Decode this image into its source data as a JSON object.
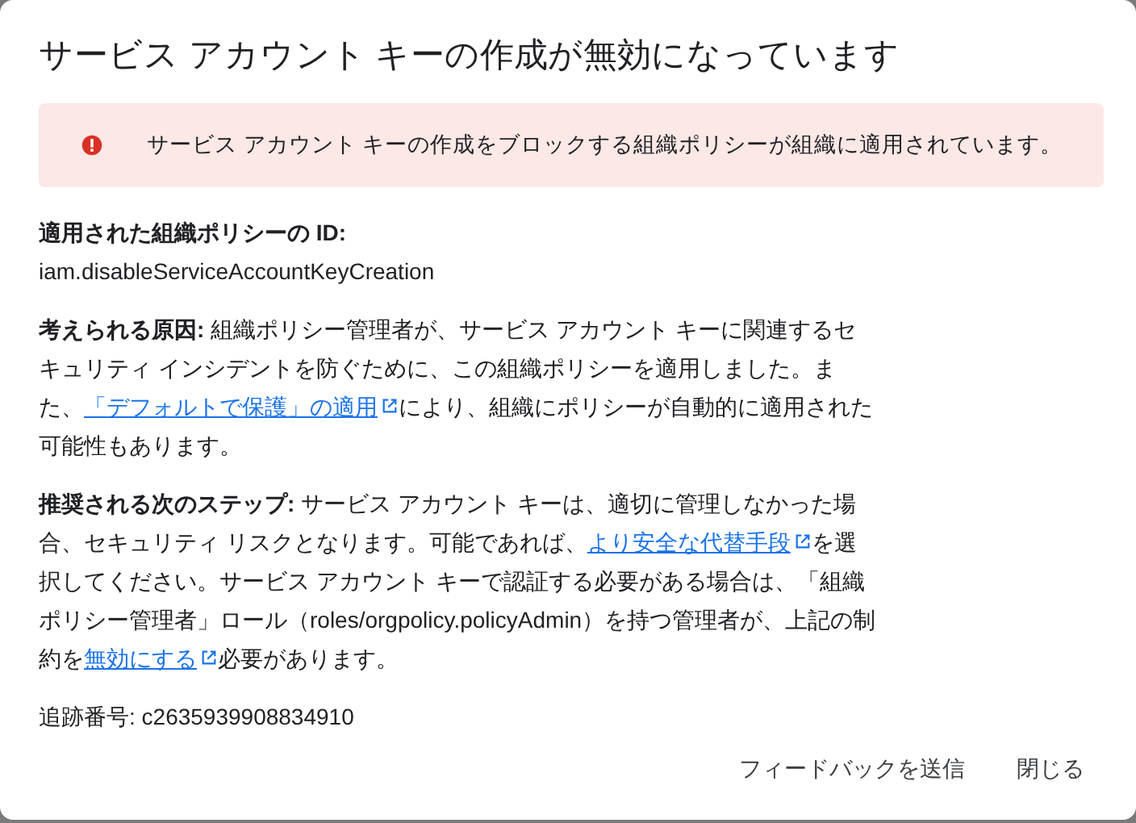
{
  "dialog": {
    "title": "サービス アカウント キーの作成が無効になっています",
    "banner": {
      "text": "サービス アカウント キーの作成をブロックする組織ポリシーが組織に適用されています。"
    },
    "policy_label": "適用された組織ポリシーの ID:",
    "policy_id": "iam.disableServiceAccountKeyCreation",
    "paragraphs": [
      [
        {
          "kind": "text",
          "text": "**考えられる原因:** 組織ポリシー管理者が、サービス アカウント キーに関連するセキュリティ インシデントを防ぐために、この組織ポリシーを適用しました。また、"
        },
        {
          "kind": "link",
          "text": "「デフォルトで保護」の適用"
        },
        {
          "kind": "text",
          "text": "により、組織にポリシーが自動的に適用された可能性もあります。"
        }
      ],
      [
        {
          "kind": "text",
          "text": "**推奨される次のステップ:** サービス アカウント キーは、適切に管理しなかった場合、セキュリティ リスクとなります。可能であれば、"
        },
        {
          "kind": "link",
          "text": "より安全な代替手段"
        },
        {
          "kind": "text",
          "text": "を選択してください。サービス アカウント キーで認証する必要がある場合は、「組織ポリシー管理者」ロール（roles/orgpolicy.policyAdmin）を持つ管理者が、上記の制約を"
        },
        {
          "kind": "link",
          "text": "無効にする"
        },
        {
          "kind": "text",
          "text": "必要があります。"
        }
      ]
    ],
    "tracking": "追跡番号: c2635939908834910",
    "buttons": [
      "フィードバックを送信",
      "閉じる"
    ]
  }
}
